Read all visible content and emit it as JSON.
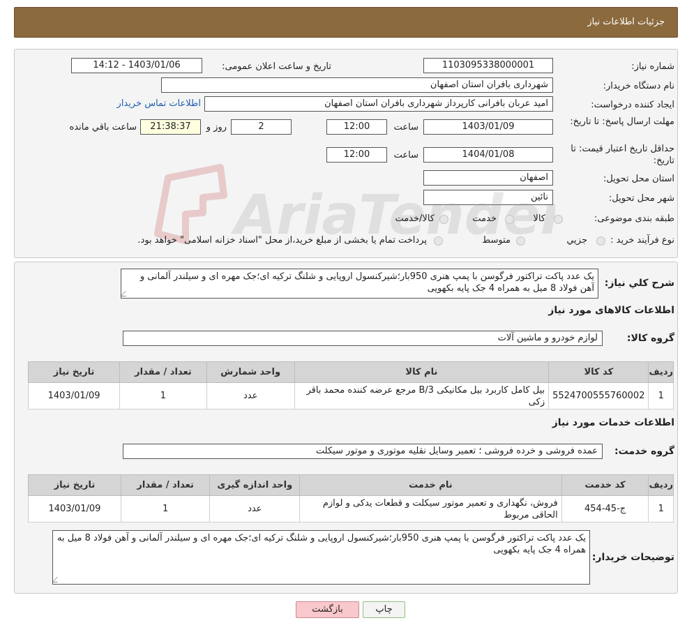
{
  "header": {
    "title": "جزئیات اطلاعات نیاز"
  },
  "form": {
    "need_number_label": "شماره نیاز:",
    "need_number": "1103095338000001",
    "announce_label": "تاریخ و ساعت اعلان عمومی:",
    "announce_value": "1403/01/06 - 14:12",
    "buyer_org_label": "نام دستگاه خریدار:",
    "buyer_org": "شهرداری بافران استان اصفهان",
    "requester_label": "ایجاد کننده درخواست:",
    "requester": "امید عربان بافرانی کارپرداز شهرداری بافران استان اصفهان",
    "contact_link": "اطلاعات تماس خریدار",
    "deadline_label": "مهلت ارسال پاسخ: تا تاریخ:",
    "deadline_date": "1403/01/09",
    "time_word": "ساعت",
    "deadline_time": "12:00",
    "days_value": "2",
    "days_word": "روز و",
    "remaining_time": "21:38:37",
    "remaining_word": "ساعت باقي مانده",
    "validity_label": "حداقل تاریخ اعتبار قیمت: تا تاریخ:",
    "validity_date": "1404/01/08",
    "validity_time": "12:00",
    "province_label": "استان محل تحویل:",
    "province": "اصفهان",
    "city_label": "شهر محل تحویل:",
    "city": "نائین",
    "category_label": "طبقه بندی موضوعی:",
    "category_options": [
      "کالا",
      "خدمت",
      "کالا/خدمت"
    ],
    "process_label": "نوع فرآیند خرید :",
    "process_options": [
      "جزیي",
      "متوسط"
    ],
    "process_note": "پرداخت تمام یا بخشی از مبلغ خرید،از محل \"اسناد خزانه اسلامی\" خواهد بود."
  },
  "watermark": {
    "text": "AriaTender.neT"
  },
  "description": {
    "label": "شرح کلي نياز:",
    "text": "یک عدد پاکت تراکتور فرگوسن با پمپ هنری 950بار؛شیرکنسول اروپایی و شلنگ ترکیه ای؛جک مهره ای و سیلندر آلمانی و آهن فولاد 8 میل به همراه 4 جک پایه بکهویی"
  },
  "goods": {
    "section_title": "اطلاعات کالاهای مورد نیاز",
    "group_label": "گروه کالا:",
    "group_value": "لوازم خودرو و ماشین آلات",
    "columns": [
      "ردیف",
      "کد کالا",
      "نام کالا",
      "واحد شمارش",
      "تعداد / مقدار",
      "تاریخ نیاز"
    ],
    "rows": [
      [
        "1",
        "5524700555760002",
        "بیل کامل کاربرد بیل مکانیکی B/3 مرجع عرضه کننده محمد باقر زکی",
        "عدد",
        "1",
        "1403/01/09"
      ]
    ]
  },
  "services": {
    "section_title": "اطلاعات خدمات مورد نیاز",
    "group_label": "گروه خدمت:",
    "group_value": "عمده فروشی و خرده فروشی ؛ تعمیر وسایل نقلیه موتوری و موتور سیکلت",
    "columns": [
      "ردیف",
      "کد خدمت",
      "نام خدمت",
      "واحد اندازه گیری",
      "تعداد / مقدار",
      "تاریخ نیاز"
    ],
    "rows": [
      [
        "1",
        "ج-45-454",
        "فروش، نگهداری و تعمیر موتور سیکلت و قطعات یدکی و لوازم الحاقی مربوط",
        "عدد",
        "1",
        "1403/01/09"
      ]
    ]
  },
  "buyer_notes": {
    "label": "توضیحات خریدار:",
    "text": "یک عدد پاکت تراکتور فرگوسن با پمپ هنری 950بار؛شیرکنسول اروپایی و شلنگ ترکیه ای؛جک مهره ای و سیلندر آلمانی و آهن فولاد 8 میل به همراه 4 جک پایه بکهویی"
  },
  "buttons": {
    "print": "چاپ",
    "back": "بازگشت"
  }
}
